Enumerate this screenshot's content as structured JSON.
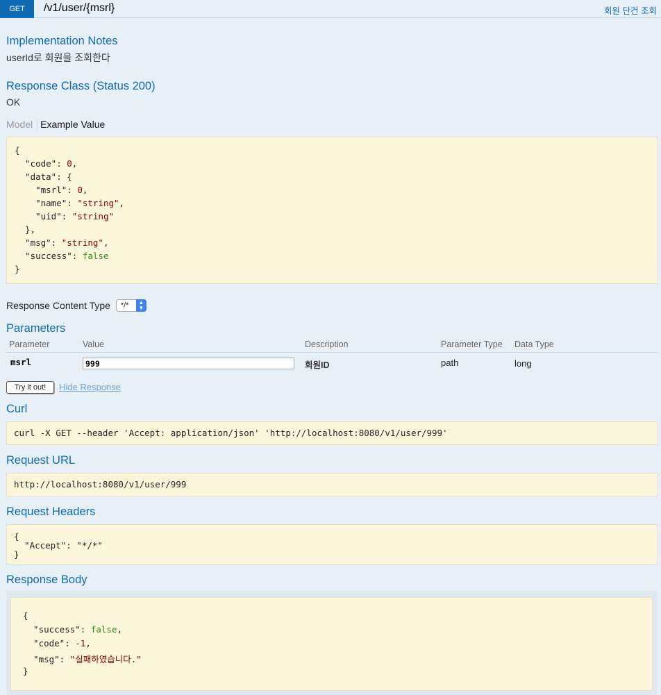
{
  "operation": {
    "method": "GET",
    "path": "/v1/user/{msrl}",
    "summary": "회원 단건 조회"
  },
  "implementation_notes": {
    "heading": "Implementation Notes",
    "text": "userId로 회원을 조회한다"
  },
  "response_class": {
    "heading": "Response Class (Status 200)",
    "status_text": "OK",
    "tabs": {
      "model": "Model",
      "example": "Example Value"
    },
    "example_lines": [
      [
        {
          "t": "{",
          "c": "k"
        }
      ],
      [
        {
          "t": "  \"code\": ",
          "c": "k"
        },
        {
          "t": "0",
          "c": "num"
        },
        {
          "t": ",",
          "c": "k"
        }
      ],
      [
        {
          "t": "  \"data\": {",
          "c": "k"
        }
      ],
      [
        {
          "t": "    \"msrl\": ",
          "c": "k"
        },
        {
          "t": "0",
          "c": "num"
        },
        {
          "t": ",",
          "c": "k"
        }
      ],
      [
        {
          "t": "    \"name\": ",
          "c": "k"
        },
        {
          "t": "\"string\"",
          "c": "str"
        },
        {
          "t": ",",
          "c": "k"
        }
      ],
      [
        {
          "t": "    \"uid\": ",
          "c": "k"
        },
        {
          "t": "\"string\"",
          "c": "str"
        }
      ],
      [
        {
          "t": "  },",
          "c": "k"
        }
      ],
      [
        {
          "t": "  \"msg\": ",
          "c": "k"
        },
        {
          "t": "\"string\"",
          "c": "str"
        },
        {
          "t": ",",
          "c": "k"
        }
      ],
      [
        {
          "t": "  \"success\": ",
          "c": "k"
        },
        {
          "t": "false",
          "c": "bool"
        }
      ],
      [
        {
          "t": "}",
          "c": "k"
        }
      ]
    ]
  },
  "content_type": {
    "label": "Response Content Type",
    "selected": "*/*"
  },
  "parameters": {
    "heading": "Parameters",
    "columns": [
      "Parameter",
      "Value",
      "Description",
      "Parameter Type",
      "Data Type"
    ],
    "rows": [
      {
        "name": "msrl",
        "value": "999",
        "description": "회원ID",
        "param_type": "path",
        "data_type": "long"
      }
    ]
  },
  "actions": {
    "try_label": "Try it out!",
    "hide_label": "Hide Response"
  },
  "curl": {
    "heading": "Curl",
    "command": "curl -X GET --header 'Accept: application/json' 'http://localhost:8080/v1/user/999'"
  },
  "request_url": {
    "heading": "Request URL",
    "url": "http://localhost:8080/v1/user/999"
  },
  "request_headers": {
    "heading": "Request Headers",
    "lines": [
      [
        {
          "t": "{",
          "c": "k"
        }
      ],
      [
        {
          "t": "  \"Accept\": \"*/*\"",
          "c": "k"
        }
      ],
      [
        {
          "t": "}",
          "c": "k"
        }
      ]
    ]
  },
  "response_body": {
    "heading": "Response Body",
    "lines": [
      [
        {
          "t": "{",
          "c": "k"
        }
      ],
      [
        {
          "t": "  \"success\": ",
          "c": "k"
        },
        {
          "t": "false",
          "c": "bool"
        },
        {
          "t": ",",
          "c": "k"
        }
      ],
      [
        {
          "t": "  \"code\": ",
          "c": "k"
        },
        {
          "t": "-1",
          "c": "num"
        },
        {
          "t": ",",
          "c": "k"
        }
      ],
      [
        {
          "t": "  \"msg\": ",
          "c": "k"
        },
        {
          "t": "\"실패하였습니다.\"",
          "c": "str"
        }
      ],
      [
        {
          "t": "}",
          "c": "k"
        }
      ]
    ]
  },
  "colors": {
    "accent": "#0f6ab4",
    "background": "#e7f0f7",
    "code_background": "#fcf6db"
  }
}
